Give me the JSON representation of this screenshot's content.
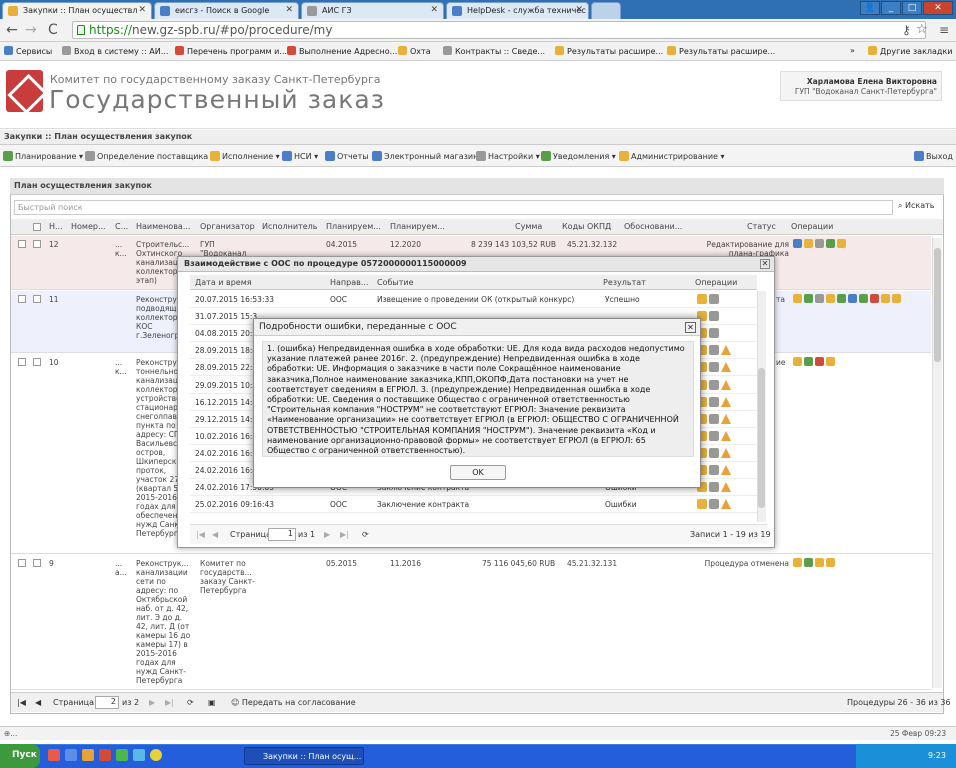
{
  "browser": {
    "tabs": [
      {
        "label": "Закупки :: План осуществл"
      },
      {
        "label": "еисгз - Поиск в Google"
      },
      {
        "label": "АИС ГЗ"
      },
      {
        "label": "HelpDesk - служба техничес"
      }
    ],
    "url_scheme": "https://",
    "url_rest": "new.gz-spb.ru/#po/procedure/my",
    "bookmarks": [
      {
        "label": "Сервисы"
      },
      {
        "label": "Вход в систему :: АИ..."
      },
      {
        "label": "Перечень программ и..."
      },
      {
        "label": "Выполнение Адресно..."
      },
      {
        "label": "Охта"
      },
      {
        "label": "Контракты :: Сведе..."
      },
      {
        "label": "Результаты расшире..."
      },
      {
        "label": "Результаты расшире..."
      }
    ],
    "other_bookmarks": "Другие закладки"
  },
  "header": {
    "subtitle": "Комитет по государственному заказу Санкт-Петербурга",
    "title": "Государственный заказ",
    "user_name": "Харламова Елена Викторовна",
    "user_org": "ГУП \"Водоканал Санкт-Петербурга\""
  },
  "breadcrumb": "Закупки :: План осуществления закупок",
  "toolbar": {
    "items": [
      {
        "label": "Планирование ▾"
      },
      {
        "label": "Определение поставщика ▾"
      },
      {
        "label": "Исполнение ▾"
      },
      {
        "label": "НСИ ▾"
      },
      {
        "label": "Отчеты"
      },
      {
        "label": "Электронный магазин"
      },
      {
        "label": "Настройки ▾"
      },
      {
        "label": "Уведомления ▾"
      },
      {
        "label": "Администрирование ▾"
      }
    ],
    "exit": "Выход"
  },
  "panel": {
    "title": "План осуществления закупок",
    "search_placeholder": "Быстрый поиск",
    "search_button": "Искать",
    "columns": [
      "Н...",
      "Номер...",
      "С...",
      "Наименова...",
      "Организатор",
      "Исполнитель",
      "Планируем...",
      "Планируем...",
      "Сумма",
      "Коды ОКПД",
      "Обосновани...",
      "Статус",
      "Операции"
    ],
    "rows": [
      {
        "n": "12",
        "s": "... к...",
        "name": "Строительс... Охтинского канализац... коллектора этап)",
        "org": "ГУП \"Водоканал",
        "plan1": "04.2015",
        "plan2": "12.2020",
        "sum": "8 239 143 103,52 RUB",
        "okpd": "45.21.32.132",
        "status": "Редактирование для плана-графика"
      },
      {
        "n": "11",
        "s": "",
        "name": "Реконструк... подводяще... коллектора КОС г.Зеленогр",
        "org": "",
        "plan1": "",
        "plan2": "",
        "sum": "",
        "okpd": "",
        "status": "та"
      },
      {
        "n": "10",
        "s": "... к...",
        "name": "Реконструк... тоннельного канализации коллектора устройство стационарн снеголпави пункта по адресу: СПб Васильевский остров, Шкиперский проток, участок 27 (квартал 5) 2015-2016 годах для обеспечения нужд Санкт-Петербурга",
        "org": "",
        "plan1": "",
        "plan2": "",
        "sum": "",
        "okpd": "",
        "status": "ие"
      },
      {
        "n": "9",
        "s": "... а...",
        "name": "Реконструк... канализации сети по адресу: по Октябрьской наб. от д. 42, лит. Э до д. 42, лит. Д (от камеры 16 до камеры 17) в 2015-2016 годах для нужд Санкт-Петербурга",
        "org": "Комитет по государств... заказу Санкт-Петербурга",
        "plan1": "05.2015",
        "plan2": "11.2016",
        "sum": "75 116 045,60 RUB",
        "okpd": "45.21.32.131",
        "status": "Процедура отменена"
      }
    ],
    "pager": {
      "page_label": "Страница",
      "page": "2",
      "of": "из 2",
      "send": "Передать на согласование",
      "summary": "Процедуры 26 - 36 из 36"
    }
  },
  "dialog1": {
    "title": "Взаимодействие с ООС по процедуре 0572000000115000009",
    "columns": [
      "Дата и время",
      "Направ...",
      "Событие",
      "Результат",
      "Операции"
    ],
    "rows": [
      {
        "dt": "20.07.2015 16:53:33",
        "dir": "ООС",
        "event": "Извещение о проведении ОК (открытый конкурс)",
        "res": "Успешно"
      },
      {
        "dt": "31.07.2015 15:3",
        "dir": "",
        "event": "",
        "res": ""
      },
      {
        "dt": "04.08.2015 20:1",
        "dir": "",
        "event": "",
        "res": ""
      },
      {
        "dt": "28.09.2015 18:4",
        "dir": "",
        "event": "",
        "res": ""
      },
      {
        "dt": "28.09.2015 22:2",
        "dir": "",
        "event": "",
        "res": ""
      },
      {
        "dt": "29.09.2015 10:2",
        "dir": "",
        "event": "",
        "res": ""
      },
      {
        "dt": "16.12.2015 14:4",
        "dir": "",
        "event": "",
        "res": ""
      },
      {
        "dt": "29.12.2015 14:3",
        "dir": "",
        "event": "",
        "res": ""
      },
      {
        "dt": "10.02.2016 16:2",
        "dir": "",
        "event": "",
        "res": ""
      },
      {
        "dt": "24.02.2016 16:1",
        "dir": "",
        "event": "",
        "res": ""
      },
      {
        "dt": "24.02.2016 16:4",
        "dir": "",
        "event": "",
        "res": ""
      },
      {
        "dt": "24.02.2016 17:50:05",
        "dir": "ООС",
        "event": "Заключение контракта",
        "res": "Ошибки"
      },
      {
        "dt": "25.02.2016 09:16:43",
        "dir": "ООС",
        "event": "Заключение контракта",
        "res": "Ошибки"
      }
    ],
    "pager": {
      "page_label": "Страница",
      "page": "1",
      "of": "из 1",
      "summary": "Записи 1 - 19 из 19"
    }
  },
  "dialog2": {
    "title": "Подробности ошибки, переданные с ООС",
    "message": "1. (ошибка) Непредвиденная ошибка в ходе обработки: UE. Для кода вида расходов недопустимо указание платежей ранее 2016г. 2. (предупреждение) Непредвиденная ошибка в ходе обработки: UE. Информация о заказчике в части поле Сокращённое наименование заказчика,Полное наименование заказчика,КПП,ОКОПФ,Дата постановки на учет не соответствует сведениям в ЕГРЮЛ. 3. (предупреждение) Непредвиденная ошибка в ходе обработки: UE. Сведения о поставщике Общество с ограниченной ответственностью \"Строительная компания \"НОСТРУМ\" не соответствуют ЕГРЮЛ: Значение реквизита «Наименование организации» не соответствует ЕГРЮЛ (в ЕГРЮЛ: ОБЩЕСТВО С ОГРАНИЧЕННОЙ ОТВЕТСТВЕННОСТЬЮ \"СТРОИТЕЛЬНАЯ КОМПАНИЯ \"НОСТРУМ\"). Значение реквизита «Код и наименование организационно-правовой формы» не соответствует ЕГРЮЛ (в ЕГРЮЛ: 65 Общество с ограниченной ответственностью).",
    "ok": "OK"
  },
  "statusbar": {
    "left": "⊕...",
    "date": "25 Февр 09:23"
  },
  "taskbar": {
    "start": "Пуск",
    "app": "Закупки :: План осущ...",
    "clock": "9:23"
  }
}
